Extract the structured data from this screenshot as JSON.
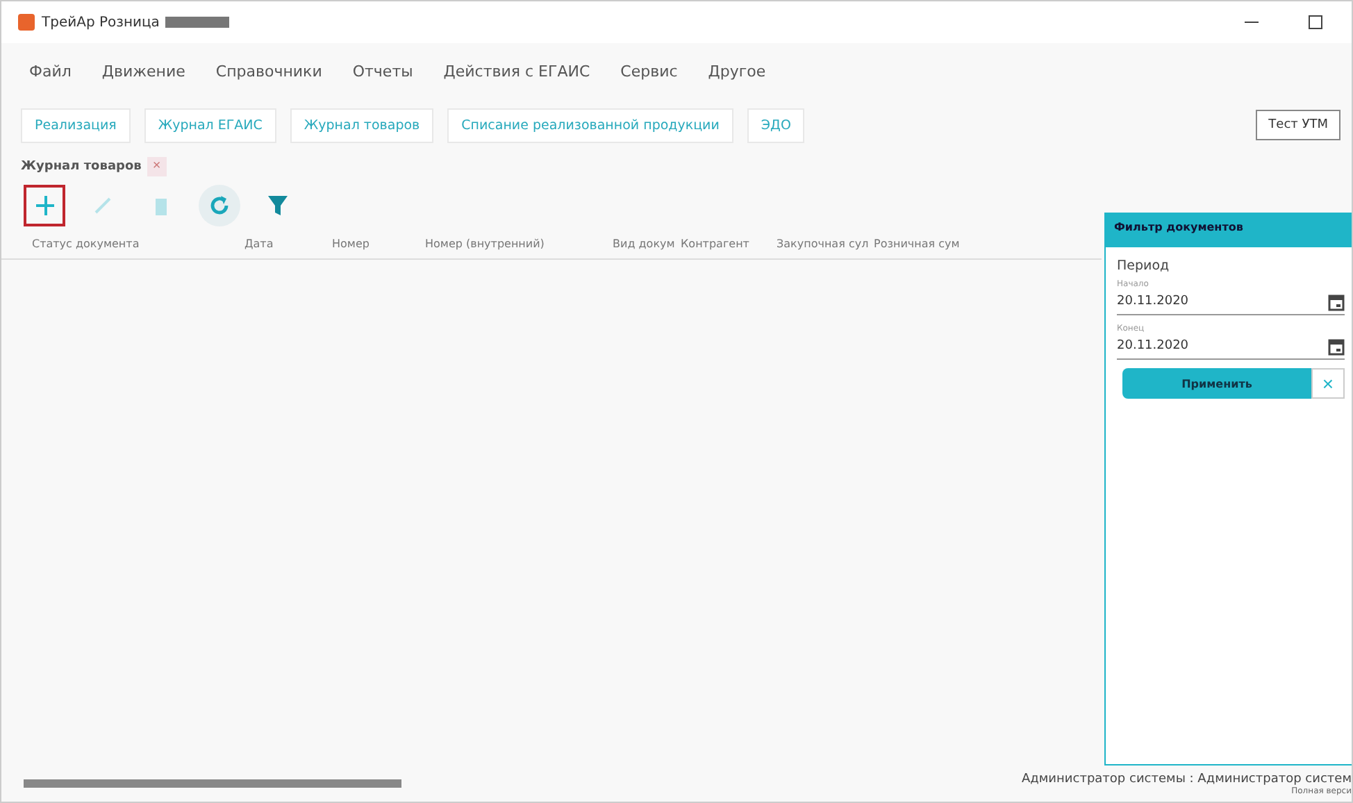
{
  "window": {
    "title": "ТрейАр Розница"
  },
  "menu": [
    "Файл",
    "Движение",
    "Справочники",
    "Отчеты",
    "Действия с ЕГАИС",
    "Сервис",
    "Другое"
  ],
  "nav_tabs": [
    "Реализация",
    "Журнал ЕГАИС",
    "Журнал товаров",
    "Списание реализованной продукции",
    "ЭДО"
  ],
  "test_button": "Тест УТМ",
  "doc_tab": {
    "label": "Журнал товаров",
    "close": "×"
  },
  "toolbar": [
    {
      "kind": "add",
      "disabled": false,
      "highlighted": true
    },
    {
      "kind": "edit",
      "disabled": true,
      "highlighted": false
    },
    {
      "kind": "delete",
      "disabled": true,
      "highlighted": false
    },
    {
      "kind": "refresh",
      "disabled": false,
      "highlighted": false
    },
    {
      "kind": "filter",
      "disabled": false,
      "highlighted": false
    }
  ],
  "table": {
    "columns": [
      "Статус документа",
      "Дата",
      "Номер",
      "Номер (внутренний)",
      "Вид докум",
      "Контрагент",
      "Закупочная сул",
      "Розничная сум"
    ]
  },
  "filter_panel": {
    "title": "Фильтр документов",
    "section": "Период",
    "fields": [
      {
        "label": "Начало",
        "value": "20.11.2020"
      },
      {
        "label": "Конец",
        "value": "20.11.2020"
      }
    ],
    "apply": "Применить",
    "clear": "×"
  },
  "status_bar": {
    "user": "Администратор системы : Администратор систем",
    "version": "Полная верси"
  }
}
